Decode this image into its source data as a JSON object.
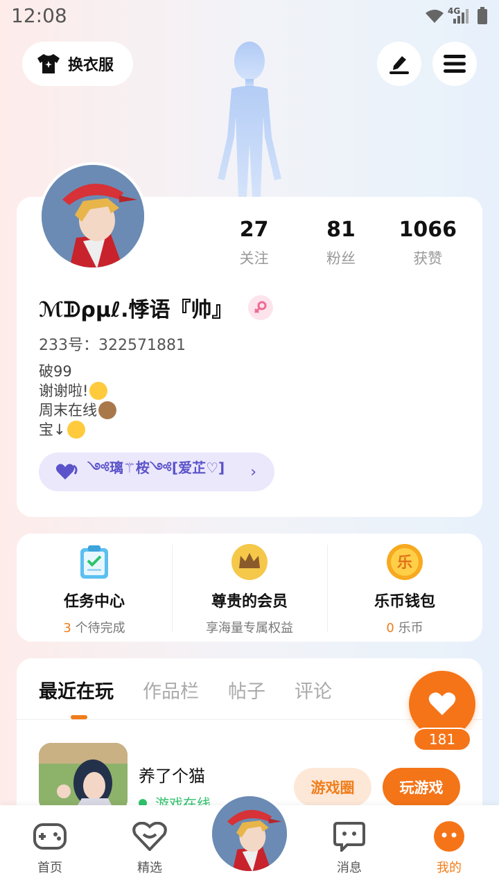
{
  "status_bar": {
    "time": "12:08",
    "network": "4G"
  },
  "header": {
    "outfit_label": "换衣服"
  },
  "profile": {
    "stats": [
      {
        "value": "27",
        "label": "关注"
      },
      {
        "value": "81",
        "label": "粉丝"
      },
      {
        "value": "1066",
        "label": "获赞"
      }
    ],
    "nickname": "ℳᗫρμℓ.悸语『帅』",
    "uid": "233号：322571881",
    "bio": [
      "破99",
      "谢谢啦!",
      "周末在线",
      "宝↓"
    ],
    "cp_text": "༺璃⚚桉༺[爱芷♡]"
  },
  "quick": [
    {
      "title": "任务中心",
      "count": "3",
      "sub": " 个待完成"
    },
    {
      "title": "尊贵的会员",
      "count": "",
      "sub": "享海量专属权益"
    },
    {
      "title": "乐币钱包",
      "count": "0",
      "sub": " 乐币",
      "icon_char": "乐"
    }
  ],
  "tabs": [
    "最近在玩",
    "作品栏",
    "帖子",
    "评论"
  ],
  "recent_game": {
    "title": "养了个猫",
    "status": "游戏在线",
    "circle_label": "游戏圈",
    "play_label": "玩游戏"
  },
  "like_count": "181",
  "nav": [
    "首页",
    "精选",
    "消息",
    "我的"
  ],
  "colors": {
    "accent": "#f47418",
    "online": "#2ec36b",
    "cp": "#5b53c9"
  }
}
